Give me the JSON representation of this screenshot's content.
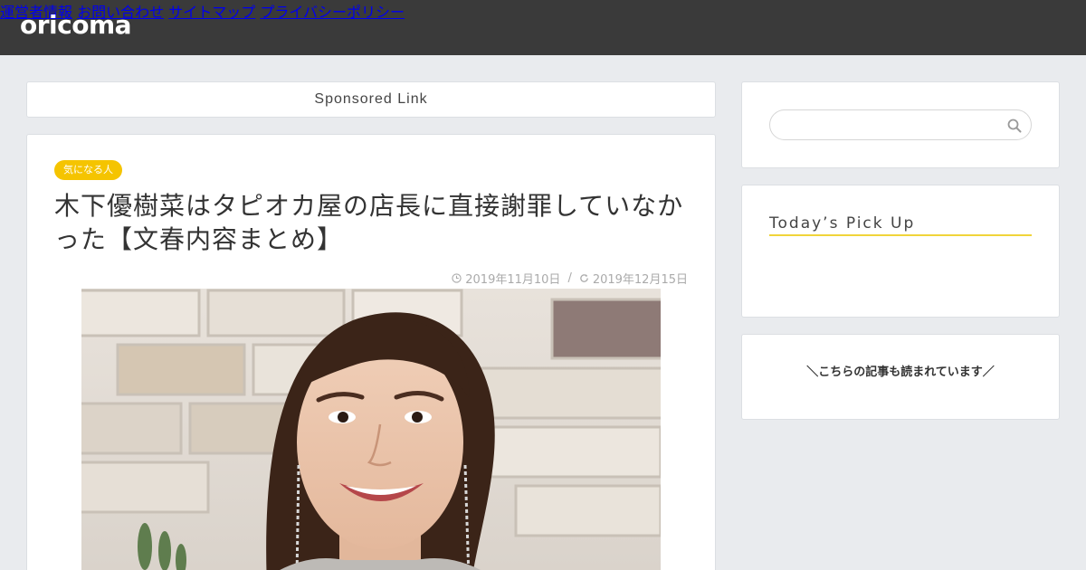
{
  "header": {
    "logo": "oricoma",
    "nav": [
      {
        "label": "運営者情報"
      },
      {
        "label": "お問い合わせ"
      },
      {
        "label": "サイトマップ"
      },
      {
        "label": "プライバシーポリシー"
      }
    ]
  },
  "main": {
    "sponsored_label": "Sponsored Link",
    "article": {
      "category": "気になる人",
      "title": "木下優樹菜はタピオカ屋の店長に直接謝罪していなかった【文春内容まとめ】",
      "published": "2019年11月10日",
      "separator": "/",
      "updated": "2019年12月15日",
      "icons": {
        "published": "clock-icon",
        "updated": "refresh-icon"
      }
    }
  },
  "sidebar": {
    "search": {
      "placeholder": "",
      "value": "",
      "icon": "search-icon"
    },
    "pick_up": {
      "title": "Today’s Pick Up"
    },
    "reads": {
      "title": "＼こちらの記事も読まれています／"
    }
  },
  "colors": {
    "header_bg": "#3a3a3a",
    "page_bg": "#e9ebee",
    "badge": "#f5c400",
    "underline": "#f0d43a"
  }
}
